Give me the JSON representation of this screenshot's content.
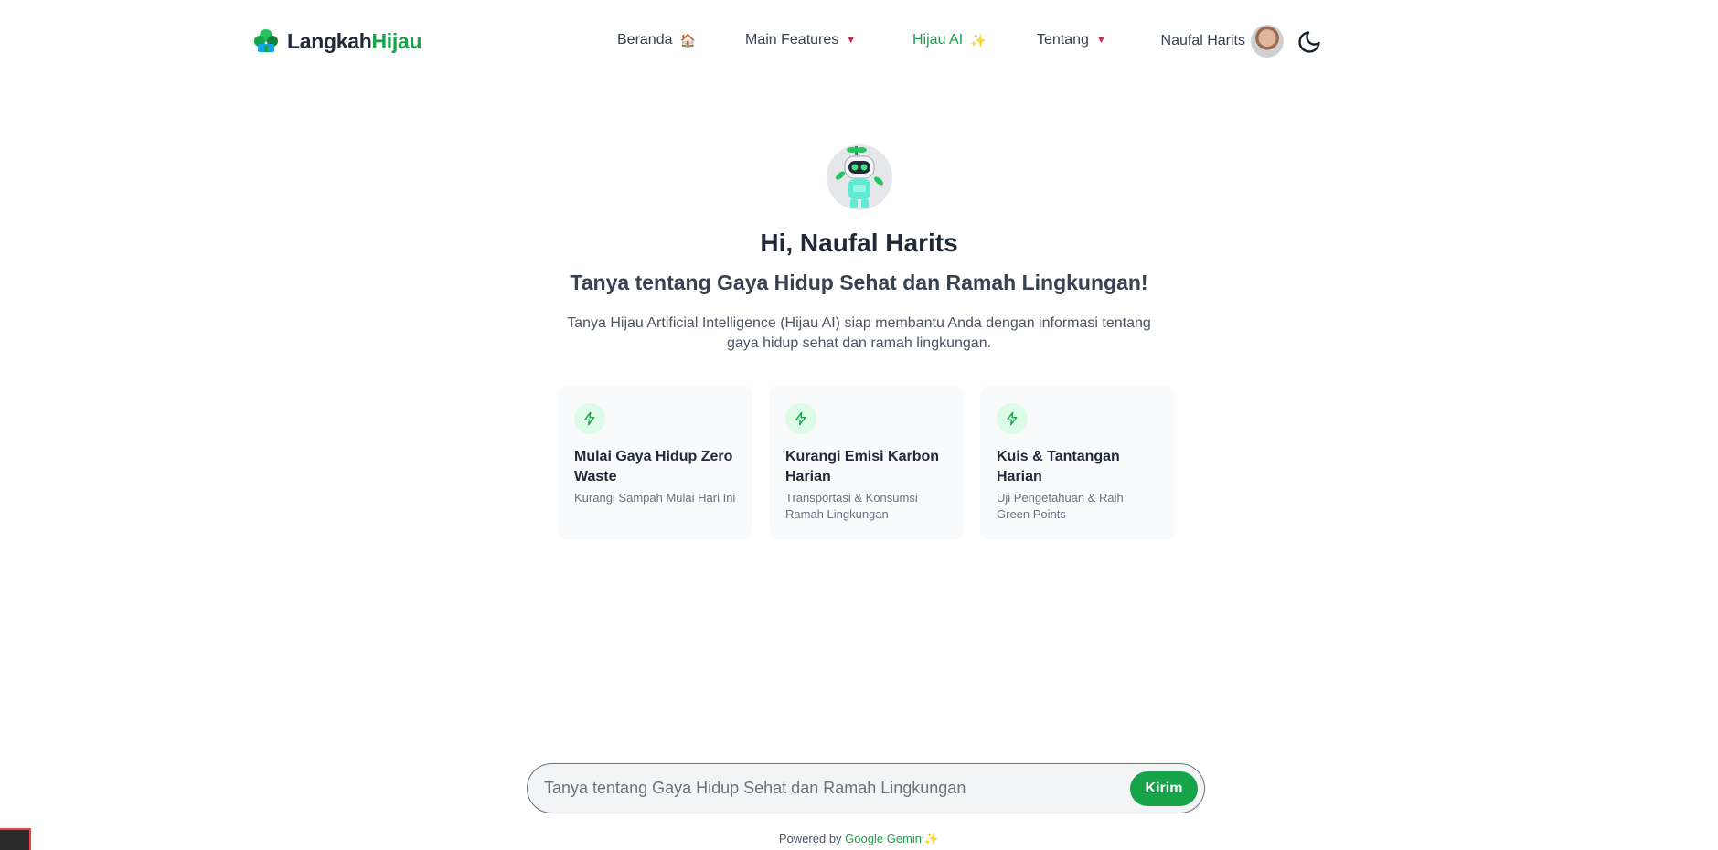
{
  "header": {
    "logo": {
      "part1": "Langkah",
      "part2": "Hijau"
    },
    "nav": [
      {
        "label": "Beranda",
        "emoji": "🏠",
        "dropdown": false,
        "active": false
      },
      {
        "label": "Main Features",
        "emoji": "",
        "dropdown": true,
        "active": false
      },
      {
        "label": "Hijau AI",
        "emoji": "✨",
        "dropdown": false,
        "active": true
      },
      {
        "label": "Tentang",
        "emoji": "",
        "dropdown": true,
        "active": false
      }
    ],
    "user_name": "Naufal Harits"
  },
  "hero": {
    "greeting": "Hi, Naufal Harits",
    "subtitle": "Tanya tentang Gaya Hidup Sehat dan Ramah Lingkungan!",
    "description": "Tanya Hijau Artificial Intelligence (Hijau AI) siap membantu Anda dengan informasi tentang gaya hidup sehat dan ramah lingkungan."
  },
  "cards": [
    {
      "title": "Mulai Gaya Hidup Zero Waste",
      "subtitle": "Kurangi Sampah Mulai Hari Ini",
      "icon": "lightning-icon"
    },
    {
      "title": "Kurangi Emisi Karbon Harian",
      "subtitle": "Transportasi & Konsumsi Ramah Lingkungan",
      "icon": "lightning-icon"
    },
    {
      "title": "Kuis & Tantangan Harian",
      "subtitle": "Uji Pengetahuan & Raih Green Points",
      "icon": "lightning-icon"
    }
  ],
  "chat": {
    "placeholder": "Tanya tentang Gaya Hidup Sehat dan Ramah Lingkungan",
    "value": "",
    "send_label": "Kirim"
  },
  "footer": {
    "powered_prefix": "Powered by ",
    "powered_brand": "Google Gemini",
    "powered_emoji": "✨"
  },
  "colors": {
    "brand_green": "#16a34a",
    "text_dark": "#1f2937",
    "card_bg": "#f9fafb",
    "caret_red": "#e11d48"
  }
}
